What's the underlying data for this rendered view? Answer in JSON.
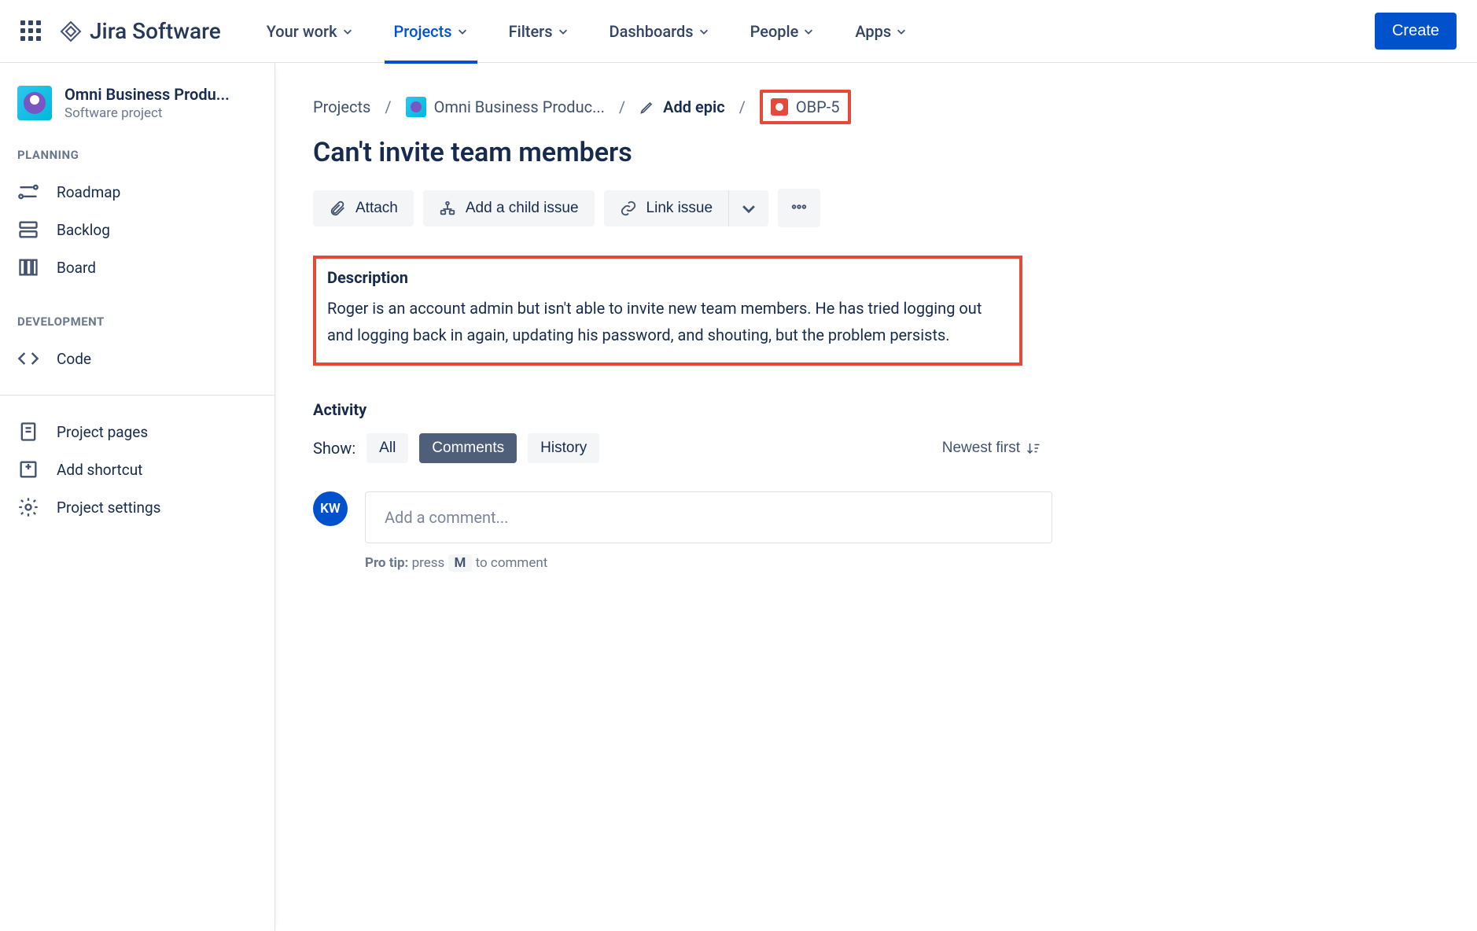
{
  "brand": {
    "name": "Jira Software"
  },
  "topnav": {
    "items": [
      {
        "label": "Your work"
      },
      {
        "label": "Projects"
      },
      {
        "label": "Filters"
      },
      {
        "label": "Dashboards"
      },
      {
        "label": "People"
      },
      {
        "label": "Apps"
      }
    ],
    "create_label": "Create"
  },
  "project": {
    "name": "Omni Business Produ...",
    "subtitle": "Software project"
  },
  "sidebar": {
    "sections": {
      "planning": {
        "label": "PLANNING",
        "items": [
          "Roadmap",
          "Backlog",
          "Board"
        ]
      },
      "development": {
        "label": "DEVELOPMENT",
        "items": [
          "Code"
        ]
      },
      "footer": [
        "Project pages",
        "Add shortcut",
        "Project settings"
      ]
    }
  },
  "breadcrumb": {
    "projects": "Projects",
    "project_name": "Omni Business Produc...",
    "add_epic": "Add epic",
    "issue_key": "OBP-5"
  },
  "issue": {
    "title": "Can't invite team members",
    "actions": {
      "attach": "Attach",
      "add_child": "Add a child issue",
      "link": "Link issue"
    },
    "description_heading": "Description",
    "description_text": "Roger is an account admin but isn't able to invite new team members. He has tried logging out and logging back in again, updating his password, and shouting, but the problem persists."
  },
  "activity": {
    "heading": "Activity",
    "show_label": "Show:",
    "tabs": {
      "all": "All",
      "comments": "Comments",
      "history": "History"
    },
    "sort": "Newest first",
    "avatar_initials": "KW",
    "comment_placeholder": "Add a comment...",
    "protip_label": "Pro tip:",
    "protip_press": "press",
    "protip_key": "M",
    "protip_rest": "to comment"
  }
}
